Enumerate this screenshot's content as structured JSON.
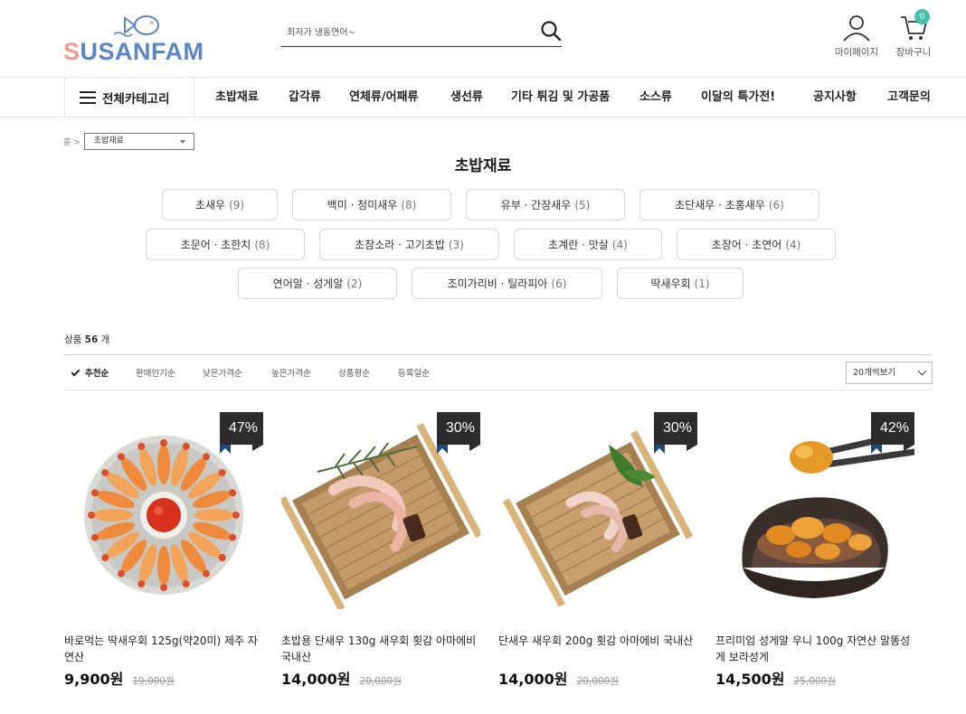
{
  "brand": {
    "logo_text_a": "S",
    "logo_text_b": "USANFAM"
  },
  "search": {
    "placeholder": "최저가 냉동연어~"
  },
  "header_links": {
    "mypage": "마이페이지",
    "cart": "장바구니",
    "cart_count": "0"
  },
  "nav": {
    "all_categories": "전체카테고리",
    "items": [
      "초밥재료",
      "갑각류",
      "연체류/어패류",
      "생선류",
      "기타 튀김 및 가공품",
      "소스류",
      "이달의 특가전!",
      "공지사항",
      "고객문의"
    ]
  },
  "breadcrumb": {
    "home": "홈 >",
    "current": "초밥재료"
  },
  "page_title": "초밥재료",
  "categories": [
    {
      "label": "초새우",
      "count": "(9)"
    },
    {
      "label": "백미 · 청미새우",
      "count": "(8)"
    },
    {
      "label": "유부 · 간장새우",
      "count": "(5)"
    },
    {
      "label": "초단새우 · 초홍새우",
      "count": "(6)"
    },
    {
      "label": "초문어 · 초한치",
      "count": "(8)"
    },
    {
      "label": "초참소라 · 고기초밥",
      "count": "(3)"
    },
    {
      "label": "초계란 · 맛살",
      "count": "(4)"
    },
    {
      "label": "초장어 · 초연어",
      "count": "(4)"
    },
    {
      "label": "연어알 · 성게알",
      "count": "(2)"
    },
    {
      "label": "조미가리비 · 틸라피아",
      "count": "(6)"
    },
    {
      "label": "딱새우회",
      "count": "(1)"
    }
  ],
  "product_count": {
    "prefix": "상품",
    "number": "56",
    "suffix": "개"
  },
  "sort": {
    "options": [
      "추천순",
      "판매인기순",
      "낮은가격순",
      "높은가격순",
      "상품평순",
      "등록일순"
    ],
    "active_index": 0,
    "per_page": "20개씩보기"
  },
  "products": [
    {
      "name": "바로먹는 딱새우회 125g(약20미) 제주 자연산",
      "price": "9,900원",
      "original_price": "19,000원",
      "discount": "47%"
    },
    {
      "name": "초밥용 단새우 130g 새우회 횟감 아마에비 국내산",
      "price": "14,000원",
      "original_price": "20,000원",
      "discount": "30%"
    },
    {
      "name": "단새우 새우회 200g 횟감 아마에비 국내산",
      "price": "14,000원",
      "original_price": "20,000원",
      "discount": "30%"
    },
    {
      "name": "프리미엄 성게알 우니 100g 자연산 말똥성게 보라성게",
      "price": "14,500원",
      "original_price": "25,000원",
      "discount": "42%"
    }
  ],
  "colors": {
    "accent": "#46c1a6",
    "logo_blue": "#5a86c6",
    "logo_pink": "#f29a8d",
    "ribbon_blue": "#1f4a7a"
  }
}
